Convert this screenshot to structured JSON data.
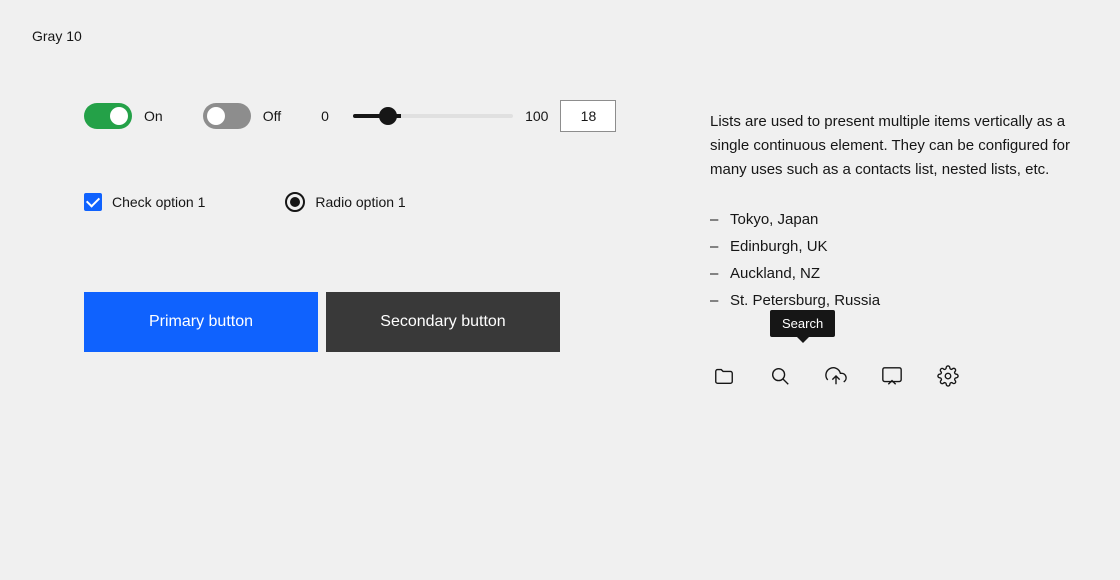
{
  "page": {
    "title": "Gray 10",
    "bg_color": "#f0f0f0"
  },
  "toggles": {
    "on_label": "On",
    "off_label": "Off"
  },
  "slider": {
    "min": "0",
    "max": "100",
    "value": "18"
  },
  "checkbox": {
    "label": "Check option 1"
  },
  "radio": {
    "label": "Radio option 1"
  },
  "buttons": {
    "primary_label": "Primary button",
    "secondary_label": "Secondary button"
  },
  "description": {
    "text": "Lists are used to present multiple items vertically as a single continuous element. They can be configured for many uses such as a contacts list, nested lists, etc.",
    "items": [
      "Tokyo, Japan",
      "Edinburgh, UK",
      "Auckland, NZ",
      "St. Petersburg, Russia"
    ]
  },
  "toolbar": {
    "tooltip_label": "Search",
    "icons": [
      "folder",
      "search",
      "upload",
      "chat",
      "settings"
    ]
  }
}
